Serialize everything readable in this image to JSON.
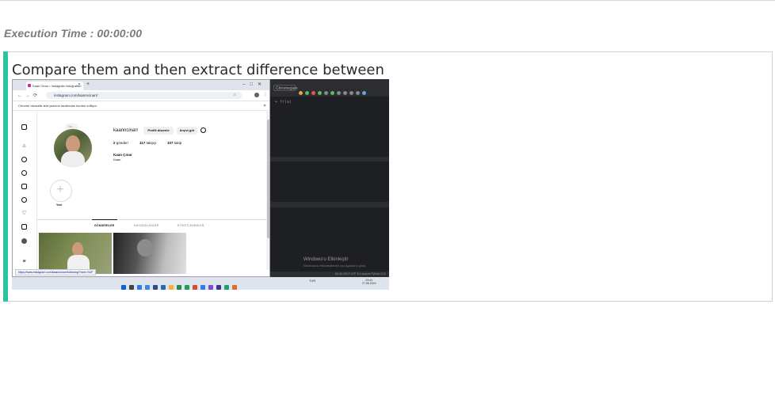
{
  "execution": {
    "label": "Execution Time : 00:00:00"
  },
  "prompt": {
    "text": "Compare them and then extract difference between"
  },
  "browser": {
    "tab_title": "Kaan Cinar • Instagram fotoğrafları",
    "url": "instagram.com/kaanncinarr/",
    "infobar_text": "Chrome otomatik test yazılımı tarafından kontrol ediliyor.",
    "status_url": "https://www.instagram.com/kaanncinarr/following/?next=%2F"
  },
  "profile": {
    "note": "Not...",
    "username": "kaanncinarr",
    "edit_button": "Profili düzenle",
    "archive_button": "Arşivi gör",
    "posts_count": "2",
    "posts_label": "gönderi",
    "followers_count": "117",
    "followers_label": "takipçi",
    "following_count": "107",
    "following_label": "takip",
    "full_name": "Kaan Çınar",
    "bio": "Kaan",
    "new_label": "Yeni",
    "tabs": [
      "GÖNDERİLER",
      "KAYDEDİLENLER",
      "ETİKETLENENLER"
    ]
  },
  "ide": {
    "code_hint": "+ fr(a)",
    "dropdown": "Chromegam",
    "watermark_title": "Windows'u Etkinleştir",
    "watermark_sub": "Windows'u etkinleştirmek için Ayarlar'a gidin.",
    "status": "66:40  CRLF  UTF-8  4 spaces  Python 3.11"
  },
  "taskbar": {
    "tray": "TUR",
    "time": "03:44",
    "date": "27.08.2024"
  },
  "colors": {
    "accent": "#2bc4a0",
    "ide_bg": "#1e1f22",
    "taskbar_bg": "#dde4ee"
  }
}
